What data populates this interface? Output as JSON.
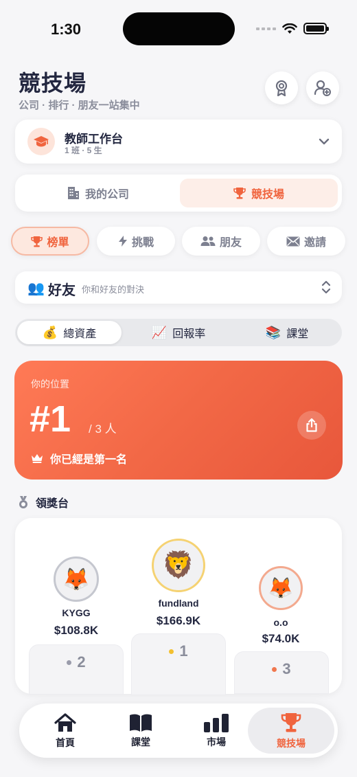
{
  "status_bar": {
    "time": "1:30"
  },
  "header": {
    "title": "競技場",
    "subtitle": "公司 · 排行 · 朋友一站集中"
  },
  "teacher": {
    "name": "教師工作台",
    "sub": "1 班 · 5 生"
  },
  "segment": {
    "company": "我的公司",
    "arena": "競技場"
  },
  "pills": [
    {
      "label": "榜單",
      "active": true
    },
    {
      "label": "挑戰",
      "active": false
    },
    {
      "label": "朋友",
      "active": false
    },
    {
      "label": "邀請",
      "active": false
    }
  ],
  "friend_selector": {
    "emoji": "👥",
    "label": "好友",
    "desc": "你和好友的對決"
  },
  "metrics": [
    {
      "emoji": "💰",
      "label": "總資產",
      "selected": true
    },
    {
      "emoji": "📈",
      "label": "回報率",
      "selected": false
    },
    {
      "emoji": "📚",
      "label": "課堂",
      "selected": false
    }
  ],
  "rank_card": {
    "label": "你的位置",
    "rank": "#1",
    "total": "/ 3 人",
    "message": "你已經是第一名"
  },
  "podium": {
    "title": "領獎台",
    "entries": [
      {
        "place": "2",
        "name": "KYGG",
        "value": "$108.8K",
        "emoji": "🦊",
        "ring": "#c5c7cf",
        "dot": "#9a9cab"
      },
      {
        "place": "1",
        "name": "fundland",
        "value": "$166.9K",
        "emoji": "🦁",
        "ring": "#f5d272",
        "dot": "#f3c030"
      },
      {
        "place": "3",
        "name": "o.o",
        "value": "$74.0K",
        "emoji": "🦊",
        "ring": "#f3a98e",
        "dot": "#f0774e"
      }
    ]
  },
  "tabbar": {
    "items": [
      {
        "label": "首頁",
        "icon": "home-icon"
      },
      {
        "label": "課堂",
        "icon": "book-icon"
      },
      {
        "label": "市場",
        "icon": "bar-chart-icon"
      },
      {
        "label": "競技場",
        "icon": "trophy-icon",
        "active": true
      }
    ]
  },
  "colors": {
    "accent": "#f0643e",
    "accent_soft": "#fde8df",
    "text": "#232740",
    "muted": "#8a8d9b"
  }
}
